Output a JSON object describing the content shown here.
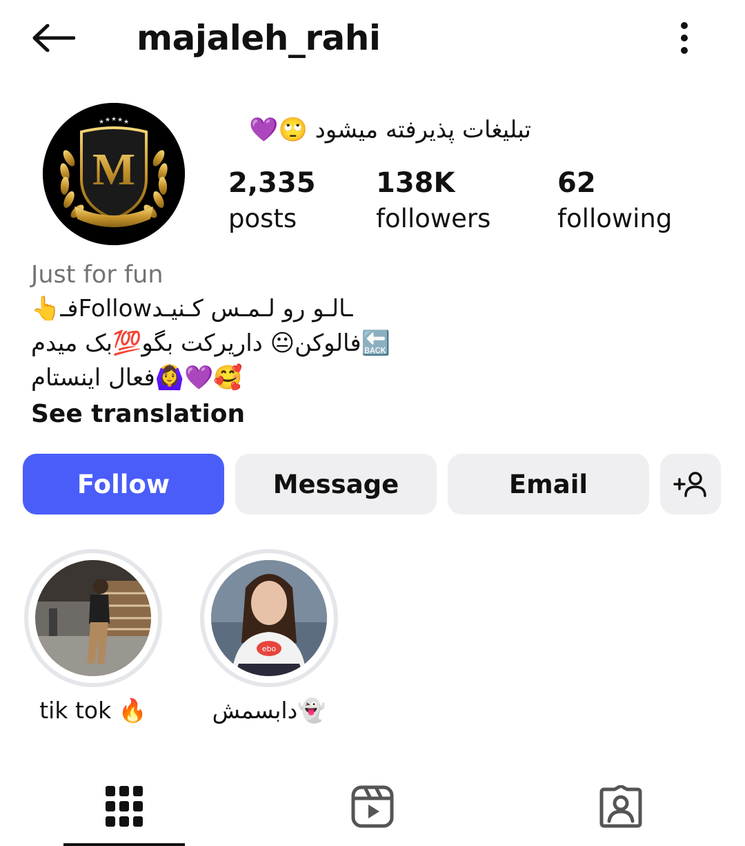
{
  "header": {
    "username": "majaleh_rahi",
    "back_icon": "arrow-left-icon",
    "more_icon": "more-vertical-icon"
  },
  "profile": {
    "tagline_text": "تبلیغات پذیرفته میشود",
    "tagline_emoji": "🙄💜",
    "avatar_letter": "M",
    "stats": {
      "posts": {
        "count": "2,335",
        "label": "posts"
      },
      "followers": {
        "count": "138K",
        "label": "followers"
      },
      "following": {
        "count": "62",
        "label": "following"
      }
    }
  },
  "bio": {
    "category": "Just for fun",
    "lines": [
      "ـالـو رو لـمـس کـنیـدFollowفـ👆",
      "🔙فالوکن😐 داریرکت بگو💯بک میدم",
      "🥰💜🙆‍♀️فعال اینستام"
    ],
    "see_translation": "See translation"
  },
  "actions": {
    "follow": "Follow",
    "message": "Message",
    "email": "Email",
    "add_user_icon": "add-user-icon"
  },
  "highlights": [
    {
      "label": "tik tok 🔥"
    },
    {
      "label": "دابسمش👻"
    }
  ],
  "tabs": [
    {
      "icon": "grid-icon",
      "active": true
    },
    {
      "icon": "reels-icon",
      "active": false
    },
    {
      "icon": "tagged-icon",
      "active": false
    }
  ],
  "colors": {
    "primary_button": "#4a5df9",
    "secondary_button": "#efeff1",
    "muted_text": "#737373",
    "gold": "#d4a940"
  }
}
